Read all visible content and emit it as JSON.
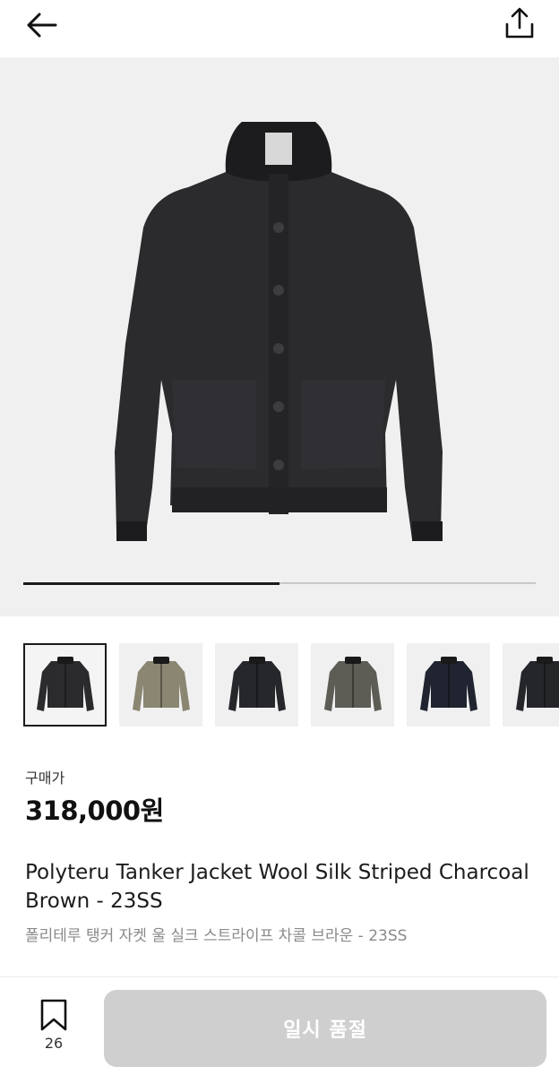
{
  "header": {
    "back_icon": "arrow-left-icon",
    "share_icon": "share-upload-icon"
  },
  "gallery": {
    "progress_fraction": 0.5,
    "thumbnail_count": 6,
    "active_index": 0,
    "thumb_colors": [
      "#2b2b2e",
      "#8a8672",
      "#26272b",
      "#5d5c55",
      "#1f2430",
      "#25262a"
    ]
  },
  "product": {
    "price_label": "구매가",
    "price": "318,000원",
    "name_en": "Polyteru Tanker Jacket Wool Silk Striped Charcoal Brown - 23SS",
    "name_ko": "폴리테루 탱커 자켓 울 실크 스트라이프 차콜 브라운 - 23SS"
  },
  "bottom": {
    "bookmark_icon": "bookmark-icon",
    "bookmark_count": "26",
    "buy_label": "일시 품절"
  },
  "colors": {
    "button_disabled": "#cfcfcf",
    "image_bg": "#f0f0f1"
  }
}
